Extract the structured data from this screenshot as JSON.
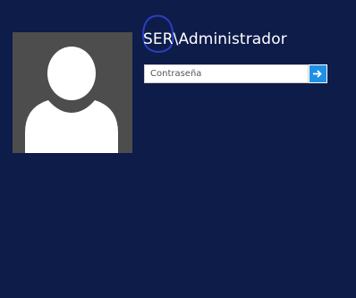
{
  "login": {
    "username": "SER\\Administrador",
    "password_placeholder": "Contraseña",
    "password_value": "",
    "submit_icon": "arrow-right-icon",
    "avatar_icon": "user-silhouette-icon"
  },
  "colors": {
    "background": "#0e1c4a",
    "avatar_bg": "#4d4d4d",
    "accent": "#1e90e6",
    "annotation": "#2a3fc4"
  }
}
